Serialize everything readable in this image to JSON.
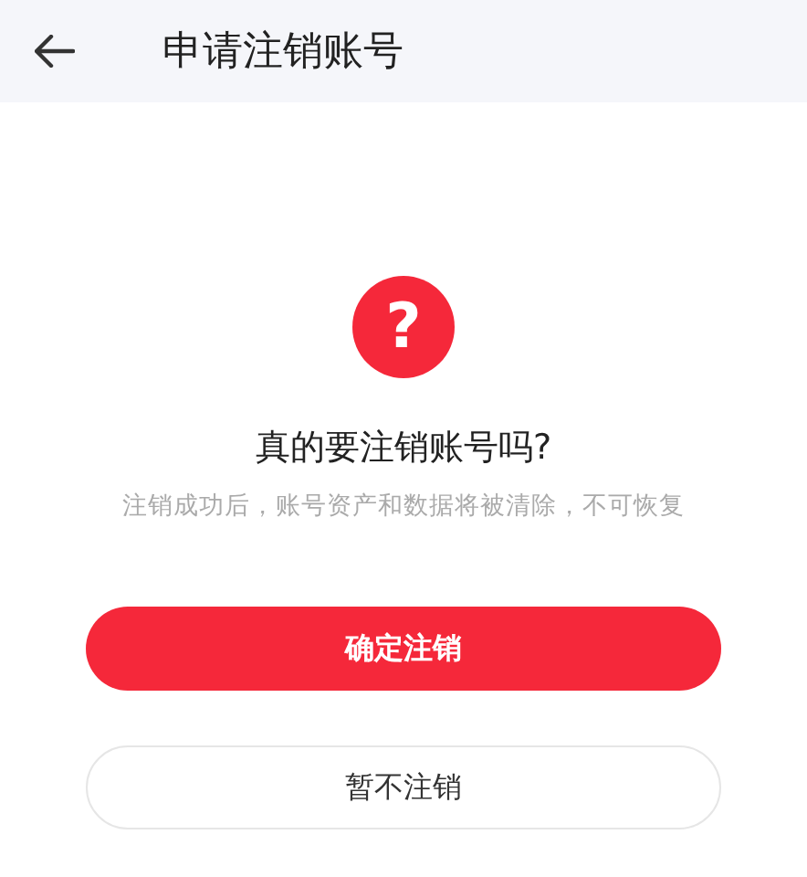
{
  "header": {
    "title": "申请注销账号"
  },
  "dialog": {
    "icon_glyph": "?",
    "question": "真的要注销账号吗?",
    "warning": "注销成功后，账号资产和数据将被清除，不可恢复"
  },
  "buttons": [
    {
      "label": "确定注销",
      "kind": "primary"
    },
    {
      "label": "暂不注销",
      "kind": "secondary"
    }
  ]
}
